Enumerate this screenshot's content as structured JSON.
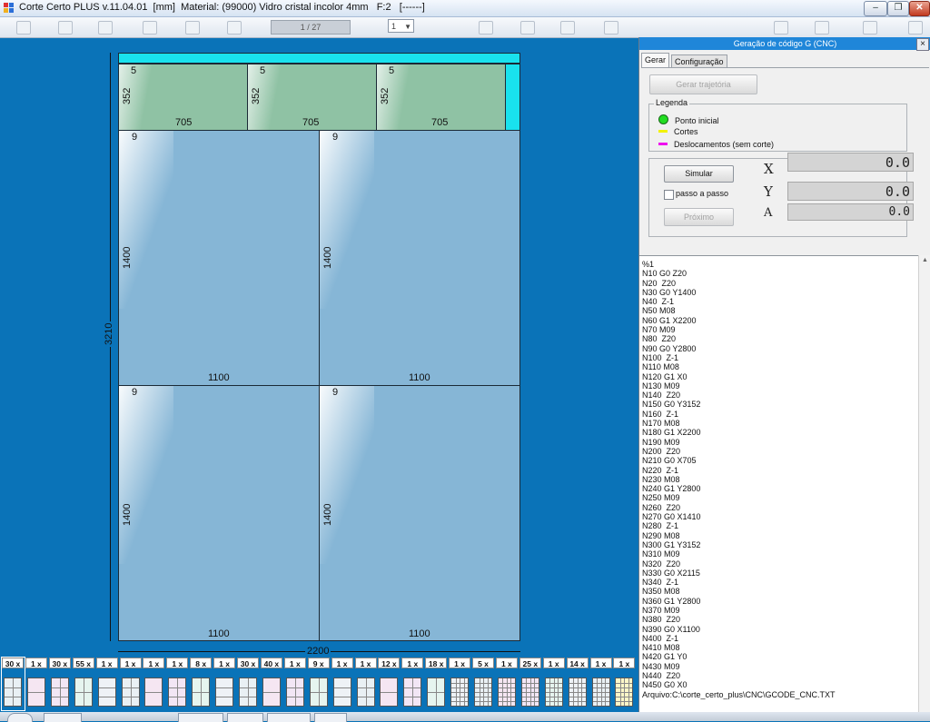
{
  "window": {
    "title": "Corte Certo PLUS v.11.04.01  [mm]  Material: (99000) Vidro cristal incolor 4mm   F:2   [------]",
    "minimize_label": "–",
    "maximize_label": "❐",
    "close_label": "✕"
  },
  "toolbar": {
    "page_indicator": "1 / 27",
    "page_select_value": "1"
  },
  "sheet": {
    "width_dim": "2200",
    "height_dim": "3210",
    "small_pieces": [
      {
        "top_label": "5",
        "side_label": "352",
        "bottom_label": "705"
      },
      {
        "top_label": "5",
        "side_label": "352",
        "bottom_label": "705"
      },
      {
        "top_label": "5",
        "side_label": "352",
        "bottom_label": "705"
      }
    ],
    "big_pieces": [
      {
        "top_label": "9",
        "side_label": "1400",
        "bottom_label": "1100"
      },
      {
        "top_label": "9",
        "side_label": "1400",
        "bottom_label": "1100"
      },
      {
        "top_label": "9",
        "side_label": "1400",
        "bottom_label": "1100"
      },
      {
        "top_label": "9",
        "side_label": "1400",
        "bottom_label": "1100"
      }
    ]
  },
  "panel": {
    "title": "Geração de código G (CNC)",
    "close_label": "×",
    "tabs": [
      "Gerar",
      "Configuração"
    ],
    "generate_button": "Gerar trajetória",
    "legend_title": "Legenda",
    "legend": [
      {
        "label": "Ponto inicial",
        "color": "#22dd22"
      },
      {
        "label": "Cortes",
        "color": "#f2f200"
      },
      {
        "label": "Deslocamentos (sem corte)",
        "color": "#ee10ee"
      }
    ],
    "simulate_button": "Simular",
    "step_checkbox_label": "passo a passo",
    "next_button": "Próximo",
    "coords": [
      {
        "axis": "X",
        "value": "0.0"
      },
      {
        "axis": "Y",
        "value": "0.0"
      },
      {
        "axis": "A",
        "value": "0.0"
      }
    ],
    "gcode": [
      "%1",
      "N10 G0 Z20",
      "N20  Z20",
      "N30 G0 Y1400",
      "N40  Z-1",
      "N50 M08",
      "N60 G1 X2200",
      "N70 M09",
      "N80  Z20",
      "N90 G0 Y2800",
      "N100  Z-1",
      "N110 M08",
      "N120 G1 X0",
      "N130 M09",
      "N140  Z20",
      "N150 G0 Y3152",
      "N160  Z-1",
      "N170 M08",
      "N180 G1 X2200",
      "N190 M09",
      "N200  Z20",
      "N210 G0 X705",
      "N220  Z-1",
      "N230 M08",
      "N240 G1 Y2800",
      "N250 M09",
      "N260  Z20",
      "N270 G0 X1410",
      "N280  Z-1",
      "N290 M08",
      "N300 G1 Y3152",
      "N310 M09",
      "N320  Z20",
      "N330 G0 X2115",
      "N340  Z-1",
      "N350 M08",
      "N360 G1 Y2800",
      "N370 M09",
      "N380  Z20",
      "N390 G0 X1100",
      "N400  Z-1",
      "N410 M08",
      "N420 G1 Y0",
      "N430 M09",
      "N440  Z20",
      "N450 G0 X0",
      "Arquivo:C:\\corte_certo_plus\\CNC\\GCODE_CNC.TXT"
    ]
  },
  "thumbnails": [
    "30 x",
    "1 x",
    "30 x",
    "55 x",
    "1 x",
    "1 x",
    "1 x",
    "1 x",
    "8 x",
    "1 x",
    "30 x",
    "40 x",
    "1 x",
    "9 x",
    "1 x",
    "1 x",
    "12 x",
    "1 x",
    "18 x",
    "1 x",
    "5 x",
    "1 x",
    "25 x",
    "1 x",
    "14 x",
    "1 x",
    "1 x"
  ]
}
